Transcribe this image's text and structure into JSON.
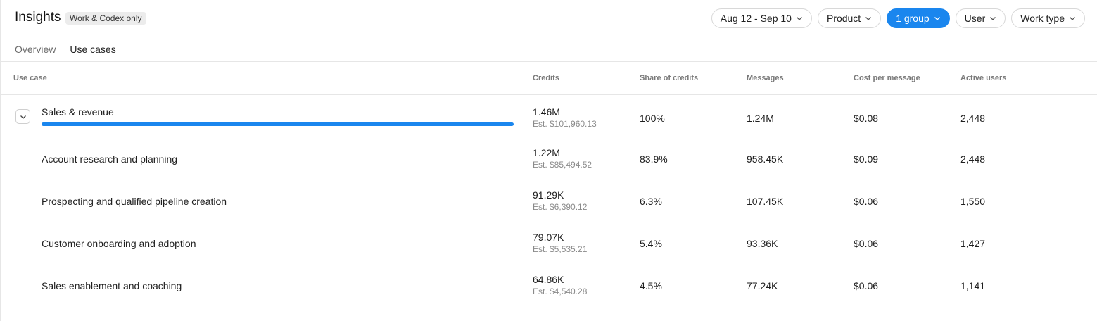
{
  "header": {
    "title": "Insights",
    "badge": "Work & Codex only"
  },
  "filters": [
    {
      "label": "Aug 12 - Sep 10",
      "active": false
    },
    {
      "label": "Product",
      "active": false
    },
    {
      "label": "1 group",
      "active": true
    },
    {
      "label": "User",
      "active": false
    },
    {
      "label": "Work type",
      "active": false
    }
  ],
  "tabs": [
    {
      "label": "Overview",
      "active": false
    },
    {
      "label": "Use cases",
      "active": true
    }
  ],
  "table": {
    "columns": [
      "Use case",
      "Credits",
      "Share of credits",
      "Messages",
      "Cost per message",
      "Active users"
    ],
    "group": {
      "name": "Sales & revenue",
      "credits": "1.46M",
      "est": "Est. $101,960.13",
      "share": "100%",
      "share_fraction": 1.0,
      "messages": "1.24M",
      "cost": "$0.08",
      "users": "2,448"
    },
    "rows": [
      {
        "name": "Account research and planning",
        "credits": "1.22M",
        "est": "Est. $85,494.52",
        "share": "83.9%",
        "messages": "958.45K",
        "cost": "$0.09",
        "users": "2,448"
      },
      {
        "name": "Prospecting and qualified pipeline creation",
        "credits": "91.29K",
        "est": "Est. $6,390.12",
        "share": "6.3%",
        "messages": "107.45K",
        "cost": "$0.06",
        "users": "1,550"
      },
      {
        "name": "Customer onboarding and adoption",
        "credits": "79.07K",
        "est": "Est. $5,535.21",
        "share": "5.4%",
        "messages": "93.36K",
        "cost": "$0.06",
        "users": "1,427"
      },
      {
        "name": "Sales enablement and coaching",
        "credits": "64.86K",
        "est": "Est. $4,540.28",
        "share": "4.5%",
        "messages": "77.24K",
        "cost": "$0.06",
        "users": "1,141"
      }
    ]
  },
  "colors": {
    "accent": "#1a86ee",
    "border": "#e6e6e6",
    "muted_text": "#8a8a8a"
  },
  "icons": {
    "filter_chevron": "chevron-down-icon",
    "expand": "chevron-down-icon"
  }
}
